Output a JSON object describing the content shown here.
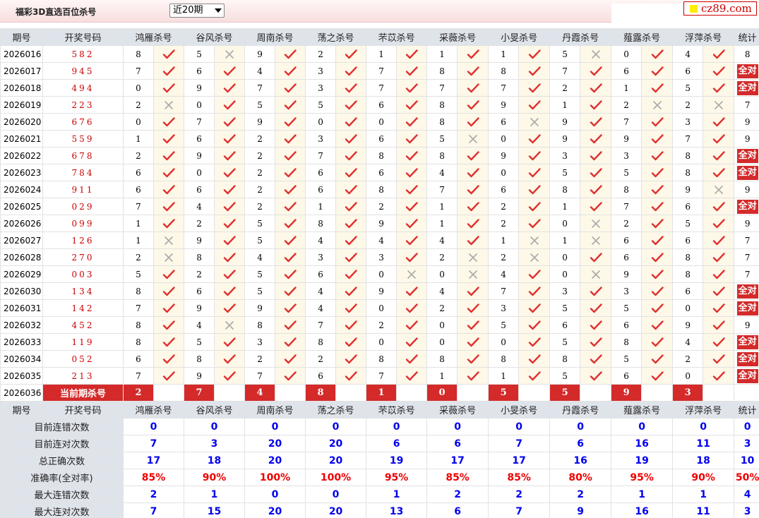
{
  "header": {
    "title": "福彩3D直选百位杀号",
    "period_select": "近20期",
    "logo_text": "cz89.com"
  },
  "table": {
    "col_period": "期号",
    "col_draw": "开奖号码",
    "col_stat": "统计",
    "experts": [
      "鸿雁杀号",
      "谷风杀号",
      "周南杀号",
      "荡之杀号",
      "芣苡杀号",
      "采薇杀号",
      "小旻杀号",
      "丹霞杀号",
      "薤露杀号",
      "浮萍杀号"
    ],
    "rows": [
      {
        "period": "2026016",
        "draw": "582",
        "kills": [
          "8",
          "5",
          "9",
          "2",
          "1",
          "1",
          "1",
          "5",
          "0",
          "4"
        ],
        "ok": [
          1,
          0,
          1,
          1,
          1,
          1,
          1,
          0,
          1,
          1
        ],
        "stat": "8"
      },
      {
        "period": "2026017",
        "draw": "945",
        "kills": [
          "7",
          "6",
          "4",
          "3",
          "7",
          "8",
          "8",
          "7",
          "6",
          "6"
        ],
        "ok": [
          1,
          1,
          1,
          1,
          1,
          1,
          1,
          1,
          1,
          1
        ],
        "stat": "全对"
      },
      {
        "period": "2026018",
        "draw": "494",
        "kills": [
          "0",
          "9",
          "7",
          "3",
          "7",
          "7",
          "7",
          "2",
          "1",
          "5"
        ],
        "ok": [
          1,
          1,
          1,
          1,
          1,
          1,
          1,
          1,
          1,
          1
        ],
        "stat": "全对"
      },
      {
        "period": "2026019",
        "draw": "223",
        "kills": [
          "2",
          "0",
          "5",
          "5",
          "6",
          "8",
          "9",
          "1",
          "2",
          "2"
        ],
        "ok": [
          0,
          1,
          1,
          1,
          1,
          1,
          1,
          1,
          0,
          0
        ],
        "stat": "7"
      },
      {
        "period": "2026020",
        "draw": "676",
        "kills": [
          "0",
          "7",
          "9",
          "0",
          "0",
          "8",
          "6",
          "9",
          "7",
          "3"
        ],
        "ok": [
          1,
          1,
          1,
          1,
          1,
          1,
          0,
          1,
          1,
          1
        ],
        "stat": "9"
      },
      {
        "period": "2026021",
        "draw": "559",
        "kills": [
          "1",
          "6",
          "2",
          "3",
          "6",
          "5",
          "0",
          "9",
          "9",
          "7"
        ],
        "ok": [
          1,
          1,
          1,
          1,
          1,
          0,
          1,
          1,
          1,
          1
        ],
        "stat": "9"
      },
      {
        "period": "2026022",
        "draw": "678",
        "kills": [
          "2",
          "9",
          "2",
          "7",
          "8",
          "8",
          "9",
          "3",
          "3",
          "8"
        ],
        "ok": [
          1,
          1,
          1,
          1,
          1,
          1,
          1,
          1,
          1,
          1
        ],
        "stat": "全对"
      },
      {
        "period": "2026023",
        "draw": "784",
        "kills": [
          "6",
          "0",
          "2",
          "6",
          "6",
          "4",
          "0",
          "5",
          "5",
          "8"
        ],
        "ok": [
          1,
          1,
          1,
          1,
          1,
          1,
          1,
          1,
          1,
          1
        ],
        "stat": "全对"
      },
      {
        "period": "2026024",
        "draw": "911",
        "kills": [
          "6",
          "6",
          "2",
          "6",
          "8",
          "7",
          "6",
          "8",
          "8",
          "9"
        ],
        "ok": [
          1,
          1,
          1,
          1,
          1,
          1,
          1,
          1,
          1,
          0
        ],
        "stat": "9"
      },
      {
        "period": "2026025",
        "draw": "029",
        "kills": [
          "7",
          "4",
          "2",
          "1",
          "2",
          "1",
          "2",
          "1",
          "7",
          "6"
        ],
        "ok": [
          1,
          1,
          1,
          1,
          1,
          1,
          1,
          1,
          1,
          1
        ],
        "stat": "全对"
      },
      {
        "period": "2026026",
        "draw": "099",
        "kills": [
          "1",
          "2",
          "5",
          "8",
          "9",
          "1",
          "2",
          "0",
          "2",
          "5"
        ],
        "ok": [
          1,
          1,
          1,
          1,
          1,
          1,
          1,
          0,
          1,
          1
        ],
        "stat": "9"
      },
      {
        "period": "2026027",
        "draw": "126",
        "kills": [
          "1",
          "9",
          "5",
          "4",
          "4",
          "4",
          "1",
          "1",
          "6",
          "6"
        ],
        "ok": [
          0,
          1,
          1,
          1,
          1,
          1,
          0,
          0,
          1,
          1
        ],
        "stat": "7"
      },
      {
        "period": "2026028",
        "draw": "270",
        "kills": [
          "2",
          "8",
          "4",
          "3",
          "3",
          "2",
          "2",
          "0",
          "6",
          "8"
        ],
        "ok": [
          0,
          1,
          1,
          1,
          1,
          0,
          0,
          1,
          1,
          1
        ],
        "stat": "7"
      },
      {
        "period": "2026029",
        "draw": "003",
        "kills": [
          "5",
          "2",
          "5",
          "6",
          "0",
          "0",
          "4",
          "0",
          "9",
          "8"
        ],
        "ok": [
          1,
          1,
          1,
          1,
          0,
          0,
          1,
          0,
          1,
          1
        ],
        "stat": "7"
      },
      {
        "period": "2026030",
        "draw": "134",
        "kills": [
          "8",
          "6",
          "5",
          "4",
          "9",
          "4",
          "7",
          "3",
          "3",
          "6"
        ],
        "ok": [
          1,
          1,
          1,
          1,
          1,
          1,
          1,
          1,
          1,
          1
        ],
        "stat": "全对"
      },
      {
        "period": "2026031",
        "draw": "142",
        "kills": [
          "7",
          "9",
          "9",
          "4",
          "0",
          "2",
          "3",
          "5",
          "5",
          "0"
        ],
        "ok": [
          1,
          1,
          1,
          1,
          1,
          1,
          1,
          1,
          1,
          1
        ],
        "stat": "全对"
      },
      {
        "period": "2026032",
        "draw": "452",
        "kills": [
          "8",
          "4",
          "8",
          "7",
          "2",
          "0",
          "5",
          "6",
          "6",
          "9"
        ],
        "ok": [
          1,
          0,
          1,
          1,
          1,
          1,
          1,
          1,
          1,
          1
        ],
        "stat": "9"
      },
      {
        "period": "2026033",
        "draw": "119",
        "kills": [
          "8",
          "5",
          "3",
          "8",
          "0",
          "0",
          "0",
          "5",
          "8",
          "4"
        ],
        "ok": [
          1,
          1,
          1,
          1,
          1,
          1,
          1,
          1,
          1,
          1
        ],
        "stat": "全对"
      },
      {
        "period": "2026034",
        "draw": "052",
        "kills": [
          "6",
          "8",
          "2",
          "2",
          "8",
          "8",
          "8",
          "8",
          "5",
          "2"
        ],
        "ok": [
          1,
          1,
          1,
          1,
          1,
          1,
          1,
          1,
          1,
          1
        ],
        "stat": "全对"
      },
      {
        "period": "2026035",
        "draw": "213",
        "kills": [
          "7",
          "9",
          "7",
          "6",
          "7",
          "1",
          "1",
          "5",
          "6",
          "0"
        ],
        "ok": [
          1,
          1,
          1,
          1,
          1,
          1,
          1,
          1,
          1,
          1
        ],
        "stat": "全对"
      }
    ],
    "current": {
      "period": "2026036",
      "label": "当前期杀号",
      "kills": [
        "2",
        "7",
        "4",
        "8",
        "1",
        "0",
        "5",
        "5",
        "9",
        "3"
      ]
    },
    "summary": [
      {
        "label": "目前连错次数",
        "values": [
          "0",
          "0",
          "0",
          "0",
          "0",
          "0",
          "0",
          "0",
          "0",
          "0"
        ],
        "stat": "0"
      },
      {
        "label": "目前连对次数",
        "values": [
          "7",
          "3",
          "20",
          "20",
          "6",
          "6",
          "7",
          "6",
          "16",
          "11"
        ],
        "stat": "3"
      },
      {
        "label": "总正确次数",
        "values": [
          "17",
          "18",
          "20",
          "20",
          "19",
          "17",
          "17",
          "16",
          "19",
          "18"
        ],
        "stat": "10"
      },
      {
        "label": "准确率(全对率)",
        "values": [
          "85%",
          "90%",
          "100%",
          "100%",
          "95%",
          "85%",
          "85%",
          "80%",
          "95%",
          "90%"
        ],
        "stat": "50%"
      },
      {
        "label": "最大连错次数",
        "values": [
          "2",
          "1",
          "0",
          "0",
          "1",
          "2",
          "2",
          "2",
          "1",
          "1"
        ],
        "stat": "4"
      },
      {
        "label": "最大连对次数",
        "values": [
          "7",
          "15",
          "20",
          "20",
          "13",
          "6",
          "7",
          "9",
          "16",
          "11"
        ],
        "stat": "3"
      }
    ]
  },
  "icons": {
    "correct": "check-icon",
    "wrong": "cross-icon"
  },
  "colors": {
    "check": "#e03030",
    "cross": "#aaaaaa",
    "badge": "#d42a2a",
    "summary_value": "#0000ee",
    "rate_value": "#ee0000"
  }
}
